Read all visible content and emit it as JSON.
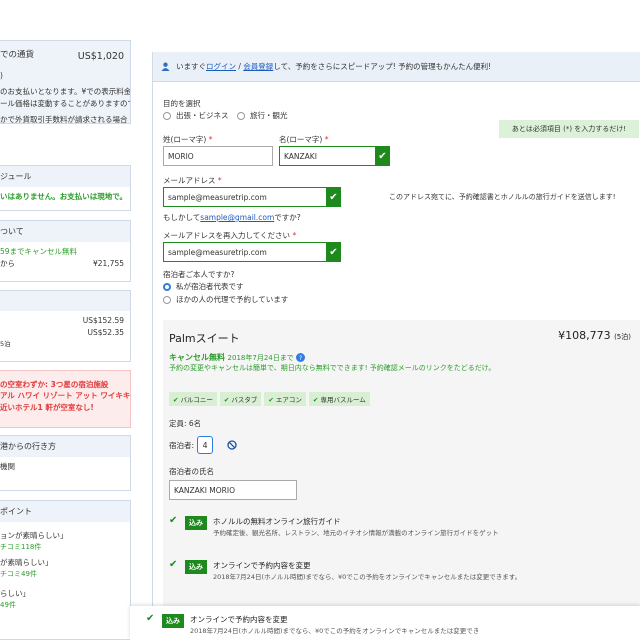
{
  "sidebar": {
    "currency_label": "での通貨",
    "currency_value": "US$1,020",
    "currency_sub": ")",
    "note1": "のお支払いとなります。¥での表示料金",
    "note2": "ール価格は変動することがありますので",
    "note3": "かで外貨取引手数料が請求される場合",
    "schedule_head": "ジュール",
    "schedule_body": "いはありません。お支払いは現地で。",
    "about_head": "ついて",
    "about_cancel": "59までキャンセル無料",
    "about_row_label": "から",
    "about_row_value": "¥21,755",
    "price_row1": "US$152.59",
    "price_row2": "US$52.35",
    "price_row3": "5泊",
    "alert1": "の空室わずか: 3つ星の宿泊施設",
    "alert2": "アル ハワイ リゾート アット ワイキキ",
    "alert3": "近いホテル1 軒が空室なし!",
    "airport_head": "港からの行き方",
    "airport_body": "機関",
    "points_head": "ポイント",
    "points": [
      {
        "label": "ョンが素晴らしい」",
        "count": "チコミ118件"
      },
      {
        "label": "が素晴らしい」",
        "count": "チコミ49件"
      },
      {
        "label": "らしい」",
        "count": "49件"
      }
    ]
  },
  "topbar": {
    "text_pre": "いますぐ",
    "login": "ログイン",
    "slash": " / ",
    "register": "会員登録",
    "text_post": "して、予約をさらにスピードアップ! 予約の管理もかんたん便利!"
  },
  "form": {
    "notice": "あとは必須項目 (*) を入力するだけ!",
    "purpose_label": "目的を選択",
    "purpose_business": "出張・ビジネス",
    "purpose_leisure": "旅行・観光",
    "lastname_label": "姓(ローマ字)",
    "lastname_value": "MORIO",
    "firstname_label": "名(ローマ字)",
    "firstname_value": "KANZAKI",
    "email_label": "メールアドレス",
    "email_value": "sample@measuretrip.com",
    "email_hint": "このアドレス宛てに、予約確認書とホノルルの旅行ガイドを送信します!",
    "suggest_pre": "もしかして",
    "suggest_link": "sample@gmail.com",
    "suggest_post": "ですか?",
    "email2_label": "メールアドレスを再入力してください",
    "email2_value": "sample@measuretrip.com",
    "required_mark": "*",
    "self_label": "宿泊者ご本人ですか?",
    "self_yes": "私が宿泊者代表です",
    "self_no": "ほかの人の代理で予約しています"
  },
  "room": {
    "name": "Palmスイート",
    "price": "¥108,773",
    "nights": "(5泊)",
    "cancel_title": "キャンセル無料",
    "cancel_date": "2018年7月24日まで",
    "cancel_note": "予約の変更やキャンセルは簡単で、期日内なら無料でできます! 予約確認メールのリンクをたどるだけ。",
    "tags": [
      "バルコニー",
      "バスタブ",
      "エアコン",
      "専用バスルーム"
    ],
    "capacity": "定員: 6名",
    "guests_label": "宿泊者:",
    "guests_value": "4",
    "guest_name_label": "宿泊者の氏名",
    "guest_name_value": "KANZAKI MORIO",
    "options": [
      {
        "badge": "込み",
        "title": "ホノルルの無料オンライン旅行ガイド",
        "desc": "予約確定後、観光名所、レストラン、地元のイチオシ情報が満載のオンライン旅行ガイドをゲット"
      },
      {
        "badge": "込み",
        "title": "オンラインで予約内容を変更",
        "desc": "2018年7月24日(ホノルル時間)までなら、¥0でこの予約をオンラインでキャンセルまたは変更できます。"
      }
    ]
  },
  "floating": {
    "badge": "込み",
    "title": "オンラインで予約内容を変更",
    "desc": "2018年7月24日(ホノルル時間)までなら、¥0でこの予約をオンラインでキャンセルまたは変更でき"
  },
  "colors": {
    "accent_green": "#1e8a1e",
    "link_blue": "#1a5bbf",
    "alert_red": "#e03a3a"
  },
  "icons": [
    "user-icon",
    "check-icon",
    "info-icon",
    "no-entry-icon"
  ]
}
